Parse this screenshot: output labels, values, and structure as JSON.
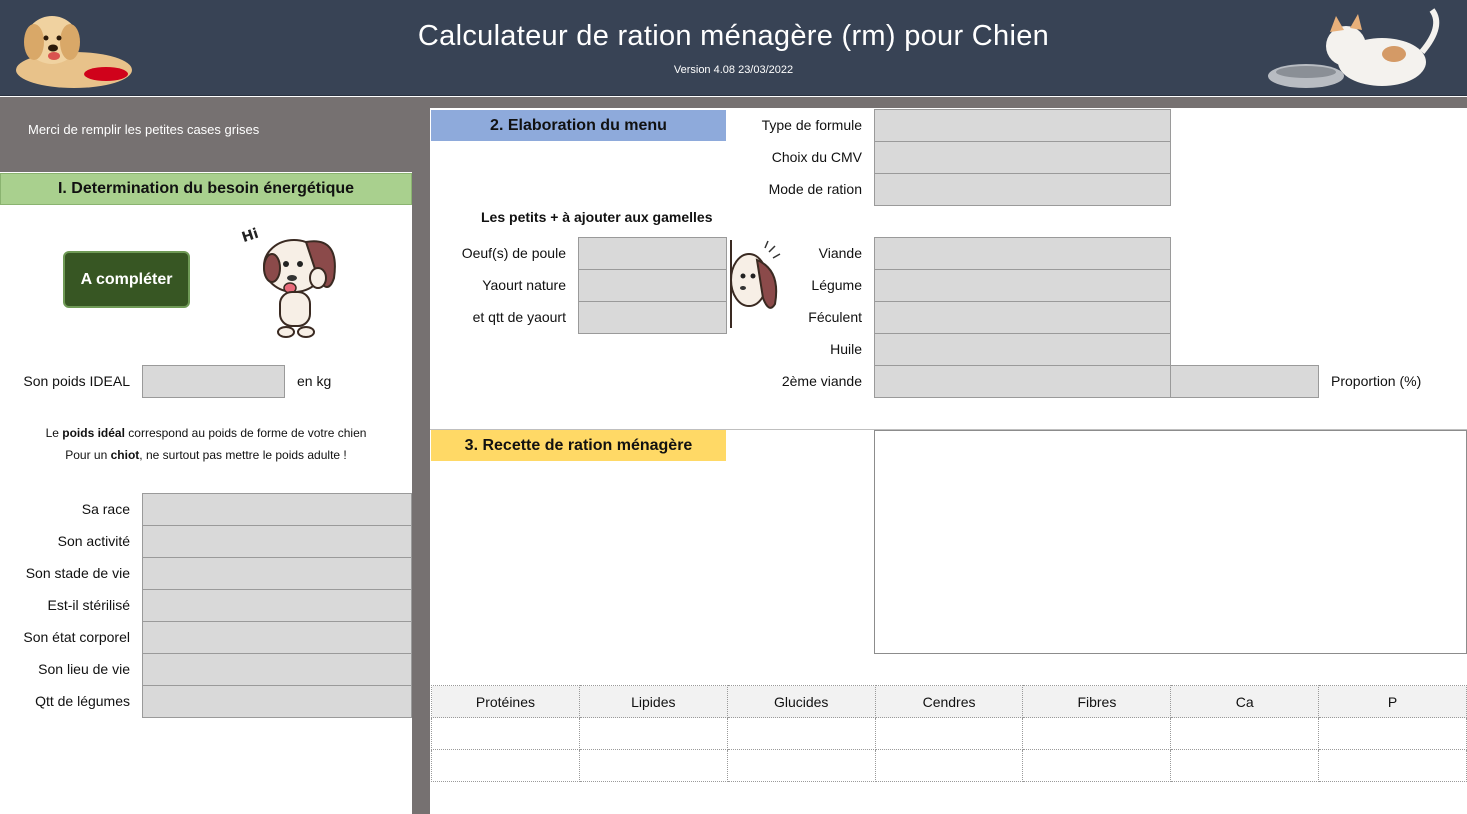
{
  "header": {
    "title": "Calculateur de ration ménagère (rm) pour Chien",
    "version": "Version 4.08 23/03/2022",
    "left_image": "golden-retriever-photo",
    "right_image": "kitten-and-bowl-photo"
  },
  "hint": "Merci de remplir les petites cases grises",
  "section1": {
    "title": "I. Determination du besoin énergétique",
    "button": "A compléter",
    "mascot": "hi-dog-cartoon",
    "poids_label": "Son poids IDEAL",
    "poids_unit": "en kg",
    "note1_a": "Le ",
    "note1_b": "poids idéal",
    "note1_c": " correspond au poids de forme de votre chien",
    "note2_a": "Pour un ",
    "note2_b": "chiot",
    "note2_c": ", ne surtout pas mettre le poids adulte !",
    "fields": [
      "Sa race",
      "Son activité",
      "Son stade de vie",
      "Est-il stérilisé",
      "Son état corporel",
      "Son lieu de vie",
      "Qtt de légumes"
    ]
  },
  "section2": {
    "title": "2. Elaboration du menu",
    "top_fields": [
      "Type de formule",
      "Choix du CMV",
      "Mode de ration"
    ],
    "extras_title": "Les petits + à ajouter aux gamelles",
    "extras_fields": [
      "Oeuf(s) de poule",
      "Yaourt nature",
      "et qtt de yaourt"
    ],
    "peek_mascot": "peeking-dog-cartoon",
    "menu_fields": [
      "Viande",
      "Légume",
      "Féculent",
      "Huile",
      "2ème viande"
    ],
    "proportion_label": "Proportion (%)"
  },
  "section3": {
    "title": "3. Recette de ration ménagère"
  },
  "nutrients": {
    "headers": [
      "Protéines",
      "Lipides",
      "Glucides",
      "Cendres",
      "Fibres",
      "Ca",
      "P"
    ]
  },
  "colors": {
    "header_bg": "#384355",
    "section1_head": "#a9d08e",
    "section2_head": "#8eaadb",
    "section3_head": "#ffd966",
    "button_bg": "#375623",
    "input_bg": "#d9d9d9",
    "side_bg": "#767171"
  }
}
